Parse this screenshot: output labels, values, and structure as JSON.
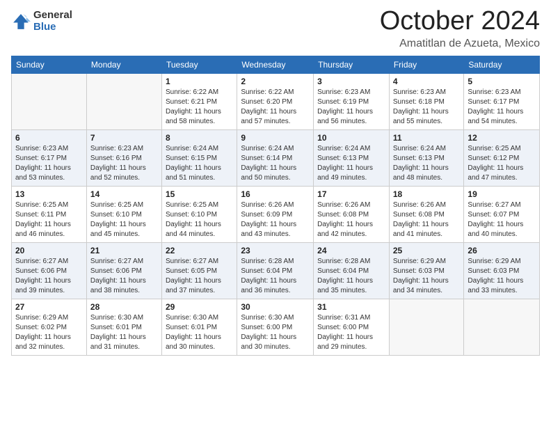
{
  "header": {
    "logo_general": "General",
    "logo_blue": "Blue",
    "month_title": "October 2024",
    "subtitle": "Amatitlan de Azueta, Mexico"
  },
  "columns": [
    "Sunday",
    "Monday",
    "Tuesday",
    "Wednesday",
    "Thursday",
    "Friday",
    "Saturday"
  ],
  "weeks": [
    [
      {
        "day": "",
        "empty": true
      },
      {
        "day": "",
        "empty": true
      },
      {
        "day": "1",
        "sunrise": "Sunrise: 6:22 AM",
        "sunset": "Sunset: 6:21 PM",
        "daylight": "Daylight: 11 hours and 58 minutes."
      },
      {
        "day": "2",
        "sunrise": "Sunrise: 6:22 AM",
        "sunset": "Sunset: 6:20 PM",
        "daylight": "Daylight: 11 hours and 57 minutes."
      },
      {
        "day": "3",
        "sunrise": "Sunrise: 6:23 AM",
        "sunset": "Sunset: 6:19 PM",
        "daylight": "Daylight: 11 hours and 56 minutes."
      },
      {
        "day": "4",
        "sunrise": "Sunrise: 6:23 AM",
        "sunset": "Sunset: 6:18 PM",
        "daylight": "Daylight: 11 hours and 55 minutes."
      },
      {
        "day": "5",
        "sunrise": "Sunrise: 6:23 AM",
        "sunset": "Sunset: 6:17 PM",
        "daylight": "Daylight: 11 hours and 54 minutes."
      }
    ],
    [
      {
        "day": "6",
        "sunrise": "Sunrise: 6:23 AM",
        "sunset": "Sunset: 6:17 PM",
        "daylight": "Daylight: 11 hours and 53 minutes."
      },
      {
        "day": "7",
        "sunrise": "Sunrise: 6:23 AM",
        "sunset": "Sunset: 6:16 PM",
        "daylight": "Daylight: 11 hours and 52 minutes."
      },
      {
        "day": "8",
        "sunrise": "Sunrise: 6:24 AM",
        "sunset": "Sunset: 6:15 PM",
        "daylight": "Daylight: 11 hours and 51 minutes."
      },
      {
        "day": "9",
        "sunrise": "Sunrise: 6:24 AM",
        "sunset": "Sunset: 6:14 PM",
        "daylight": "Daylight: 11 hours and 50 minutes."
      },
      {
        "day": "10",
        "sunrise": "Sunrise: 6:24 AM",
        "sunset": "Sunset: 6:13 PM",
        "daylight": "Daylight: 11 hours and 49 minutes."
      },
      {
        "day": "11",
        "sunrise": "Sunrise: 6:24 AM",
        "sunset": "Sunset: 6:13 PM",
        "daylight": "Daylight: 11 hours and 48 minutes."
      },
      {
        "day": "12",
        "sunrise": "Sunrise: 6:25 AM",
        "sunset": "Sunset: 6:12 PM",
        "daylight": "Daylight: 11 hours and 47 minutes."
      }
    ],
    [
      {
        "day": "13",
        "sunrise": "Sunrise: 6:25 AM",
        "sunset": "Sunset: 6:11 PM",
        "daylight": "Daylight: 11 hours and 46 minutes."
      },
      {
        "day": "14",
        "sunrise": "Sunrise: 6:25 AM",
        "sunset": "Sunset: 6:10 PM",
        "daylight": "Daylight: 11 hours and 45 minutes."
      },
      {
        "day": "15",
        "sunrise": "Sunrise: 6:25 AM",
        "sunset": "Sunset: 6:10 PM",
        "daylight": "Daylight: 11 hours and 44 minutes."
      },
      {
        "day": "16",
        "sunrise": "Sunrise: 6:26 AM",
        "sunset": "Sunset: 6:09 PM",
        "daylight": "Daylight: 11 hours and 43 minutes."
      },
      {
        "day": "17",
        "sunrise": "Sunrise: 6:26 AM",
        "sunset": "Sunset: 6:08 PM",
        "daylight": "Daylight: 11 hours and 42 minutes."
      },
      {
        "day": "18",
        "sunrise": "Sunrise: 6:26 AM",
        "sunset": "Sunset: 6:08 PM",
        "daylight": "Daylight: 11 hours and 41 minutes."
      },
      {
        "day": "19",
        "sunrise": "Sunrise: 6:27 AM",
        "sunset": "Sunset: 6:07 PM",
        "daylight": "Daylight: 11 hours and 40 minutes."
      }
    ],
    [
      {
        "day": "20",
        "sunrise": "Sunrise: 6:27 AM",
        "sunset": "Sunset: 6:06 PM",
        "daylight": "Daylight: 11 hours and 39 minutes."
      },
      {
        "day": "21",
        "sunrise": "Sunrise: 6:27 AM",
        "sunset": "Sunset: 6:06 PM",
        "daylight": "Daylight: 11 hours and 38 minutes."
      },
      {
        "day": "22",
        "sunrise": "Sunrise: 6:27 AM",
        "sunset": "Sunset: 6:05 PM",
        "daylight": "Daylight: 11 hours and 37 minutes."
      },
      {
        "day": "23",
        "sunrise": "Sunrise: 6:28 AM",
        "sunset": "Sunset: 6:04 PM",
        "daylight": "Daylight: 11 hours and 36 minutes."
      },
      {
        "day": "24",
        "sunrise": "Sunrise: 6:28 AM",
        "sunset": "Sunset: 6:04 PM",
        "daylight": "Daylight: 11 hours and 35 minutes."
      },
      {
        "day": "25",
        "sunrise": "Sunrise: 6:29 AM",
        "sunset": "Sunset: 6:03 PM",
        "daylight": "Daylight: 11 hours and 34 minutes."
      },
      {
        "day": "26",
        "sunrise": "Sunrise: 6:29 AM",
        "sunset": "Sunset: 6:03 PM",
        "daylight": "Daylight: 11 hours and 33 minutes."
      }
    ],
    [
      {
        "day": "27",
        "sunrise": "Sunrise: 6:29 AM",
        "sunset": "Sunset: 6:02 PM",
        "daylight": "Daylight: 11 hours and 32 minutes."
      },
      {
        "day": "28",
        "sunrise": "Sunrise: 6:30 AM",
        "sunset": "Sunset: 6:01 PM",
        "daylight": "Daylight: 11 hours and 31 minutes."
      },
      {
        "day": "29",
        "sunrise": "Sunrise: 6:30 AM",
        "sunset": "Sunset: 6:01 PM",
        "daylight": "Daylight: 11 hours and 30 minutes."
      },
      {
        "day": "30",
        "sunrise": "Sunrise: 6:30 AM",
        "sunset": "Sunset: 6:00 PM",
        "daylight": "Daylight: 11 hours and 30 minutes."
      },
      {
        "day": "31",
        "sunrise": "Sunrise: 6:31 AM",
        "sunset": "Sunset: 6:00 PM",
        "daylight": "Daylight: 11 hours and 29 minutes."
      },
      {
        "day": "",
        "empty": true
      },
      {
        "day": "",
        "empty": true
      }
    ]
  ]
}
